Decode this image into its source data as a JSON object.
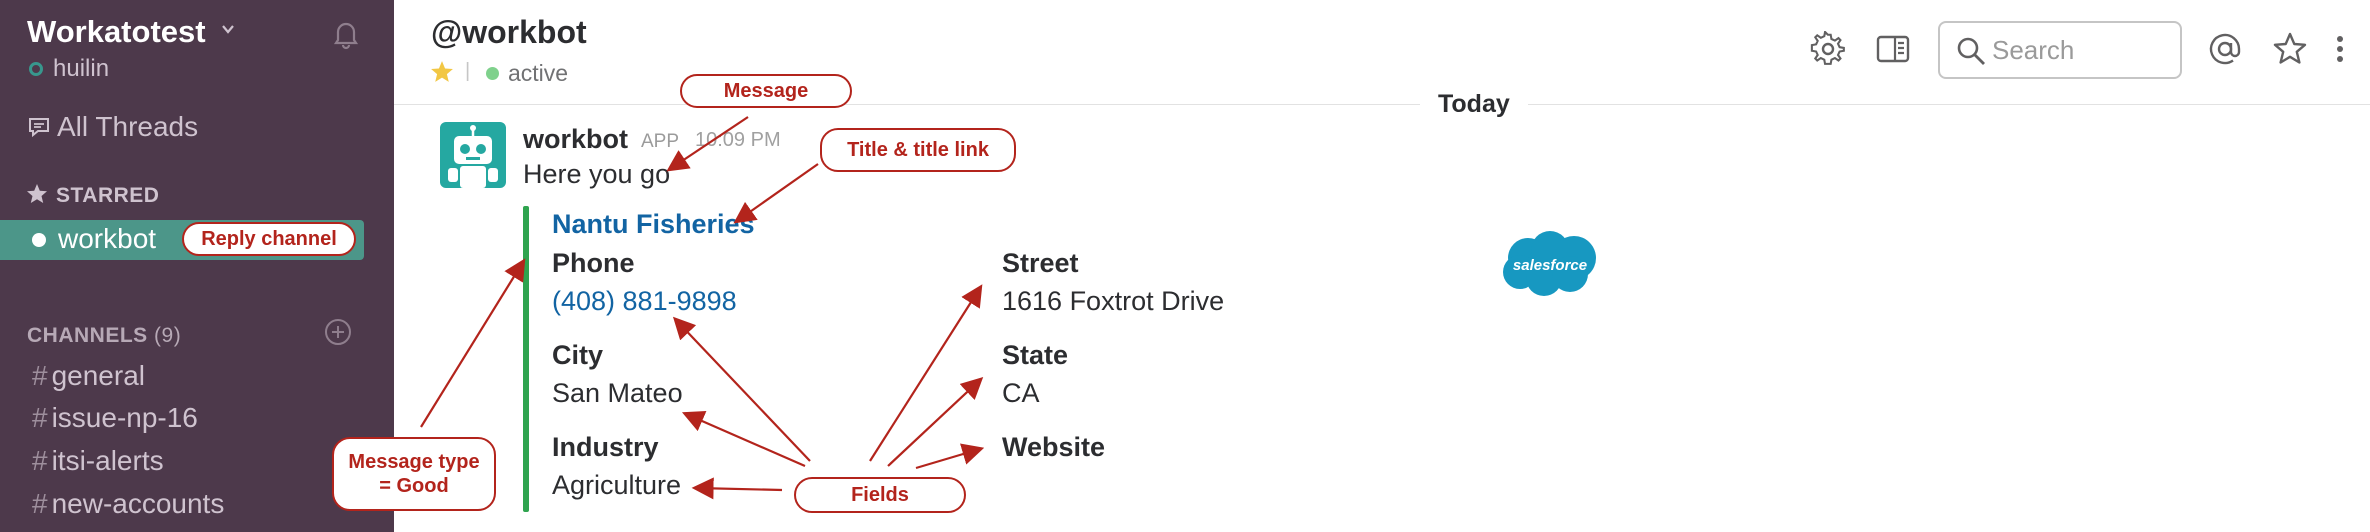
{
  "sidebar": {
    "workspace_name": "Workatotest",
    "user_name": "huilin",
    "all_threads": "All Threads",
    "starred_label": "STARRED",
    "selected_channel": "workbot",
    "channels_label": "CHANNELS",
    "channels_count": "(9)",
    "channels": [
      "general",
      "issue-np-16",
      "itsi-alerts",
      "new-accounts"
    ],
    "hash": "#"
  },
  "header": {
    "title": "@workbot",
    "separator": "|",
    "status": "active",
    "search_placeholder": "Search",
    "icons": [
      "gear-icon",
      "sidebar-toggle-icon",
      "search-icon",
      "mention-icon",
      "star-icon",
      "more-icon"
    ]
  },
  "day_divider": "Today",
  "message": {
    "sender": "workbot",
    "badge": "APP",
    "time": "10:09 PM",
    "text": "Here you go",
    "attachment": {
      "title": "Nantu Fisheries",
      "fields_left": [
        {
          "label": "Phone",
          "value": "(408) 881-9898",
          "link": true
        },
        {
          "label": "City",
          "value": "San Mateo",
          "link": false
        },
        {
          "label": "Industry",
          "value": "Agriculture",
          "link": false
        }
      ],
      "fields_right": [
        {
          "label": "Street",
          "value": "1616 Foxtrot Drive"
        },
        {
          "label": "State",
          "value": "CA"
        },
        {
          "label": "Website",
          "value": ""
        }
      ],
      "color": "#2fa44f"
    }
  },
  "logo_text": "salesforce",
  "callouts": {
    "message": "Message",
    "title_link": "Title & title link",
    "reply_channel": "Reply channel",
    "message_type_1": "Message type",
    "message_type_2": "= Good",
    "fields": "Fields"
  },
  "colors": {
    "sidebar": "#4d394b",
    "selected": "#4c9689",
    "callout": "#b3241c",
    "link": "#1264a3"
  }
}
